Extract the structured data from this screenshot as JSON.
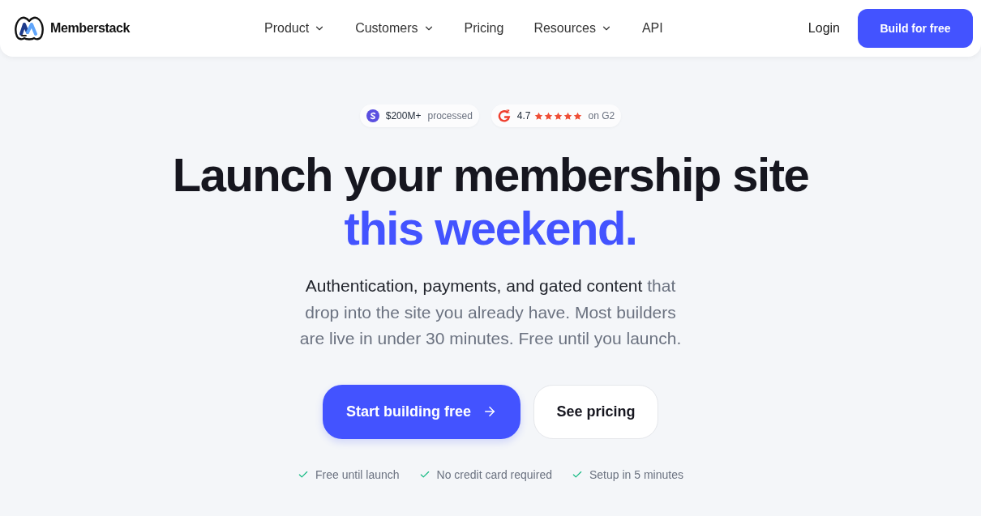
{
  "nav": {
    "brand": "Memberstack",
    "links": [
      {
        "label": "Product",
        "dropdown": true
      },
      {
        "label": "Customers",
        "dropdown": true
      },
      {
        "label": "Pricing",
        "dropdown": false
      },
      {
        "label": "Resources",
        "dropdown": true
      },
      {
        "label": "API",
        "dropdown": false
      }
    ],
    "login": "Login",
    "cta": "Build for free"
  },
  "hero": {
    "badges": [
      {
        "kind": "processed",
        "amount": "$200M+",
        "caption": "processed"
      },
      {
        "kind": "rating",
        "rating": "4.7",
        "stars": 5,
        "caption": "on G2"
      }
    ],
    "heading": {
      "line_1": "Launch your membership site",
      "line_2": "this weekend."
    },
    "subtitle": {
      "lead": "Authentication, payments, and gated content",
      "rest": "that drop into the site you already have. Most builders are live in under 30 minutes. Free until you launch."
    },
    "primary_button": "Start building free",
    "secondary_button": "See pricing",
    "assurances": [
      "Free until launch",
      "No credit card required",
      "Setup in 5 minutes"
    ]
  }
}
